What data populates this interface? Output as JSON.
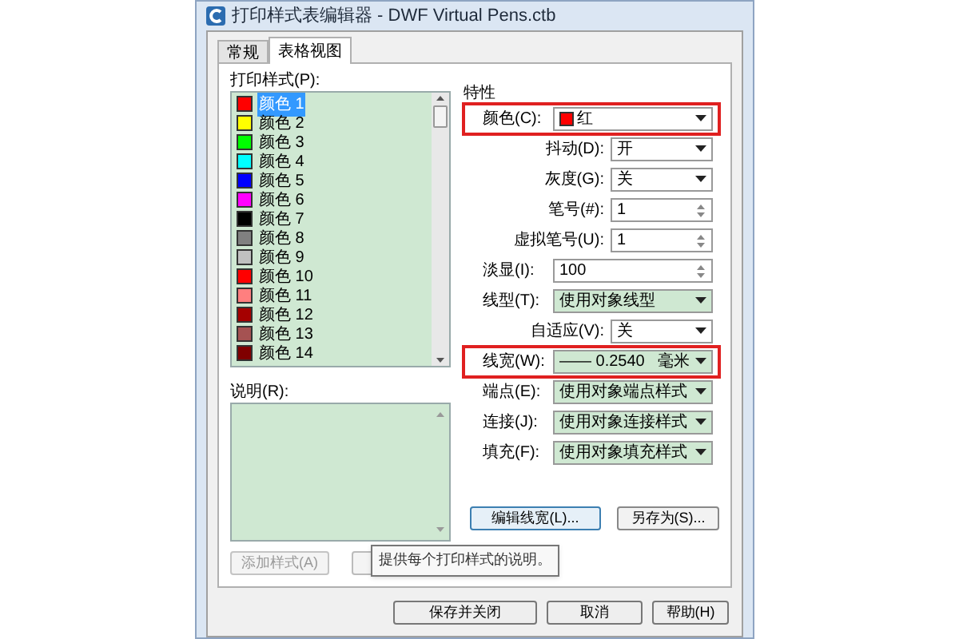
{
  "window": {
    "title": "打印样式表编辑器 - DWF Virtual Pens.ctb"
  },
  "tabs": [
    {
      "label": "常规",
      "selected": false
    },
    {
      "label": "表格视图",
      "selected": true
    }
  ],
  "styles_list": {
    "label": "打印样式(P):",
    "items": [
      {
        "label": "颜色 1",
        "color": "#ff0000",
        "selected": true
      },
      {
        "label": "颜色 2",
        "color": "#ffff00",
        "selected": false
      },
      {
        "label": "颜色 3",
        "color": "#00ff00",
        "selected": false
      },
      {
        "label": "颜色 4",
        "color": "#00ffff",
        "selected": false
      },
      {
        "label": "颜色 5",
        "color": "#0000ff",
        "selected": false
      },
      {
        "label": "颜色 6",
        "color": "#ff00ff",
        "selected": false
      },
      {
        "label": "颜色 7",
        "color": "#000000",
        "selected": false
      },
      {
        "label": "颜色 8",
        "color": "#808080",
        "selected": false
      },
      {
        "label": "颜色 9",
        "color": "#c0c0c0",
        "selected": false
      },
      {
        "label": "颜色 10",
        "color": "#ff0000",
        "selected": false
      },
      {
        "label": "颜色 11",
        "color": "#ff7f7f",
        "selected": false
      },
      {
        "label": "颜色 12",
        "color": "#a50000",
        "selected": false
      },
      {
        "label": "颜色 13",
        "color": "#a55252",
        "selected": false
      },
      {
        "label": "颜色 14",
        "color": "#7f0000",
        "selected": false
      }
    ]
  },
  "description": {
    "label": "说明(R):"
  },
  "add_style_button": {
    "label": "添加样式(A)",
    "disabled": true
  },
  "tooltip": "提供每个打印样式的说明。",
  "properties": {
    "label": "特性",
    "rows": [
      {
        "kind": "color-select",
        "label": "颜色(C):",
        "value": "红",
        "color": "#ff0000",
        "highlighted": true
      },
      {
        "kind": "select-short",
        "label": "抖动(D):",
        "value": "开",
        "highlighted": false
      },
      {
        "kind": "select-short",
        "label": "灰度(G):",
        "value": "关",
        "highlighted": false
      },
      {
        "kind": "spin-short",
        "label": "笔号(#):",
        "value": "1",
        "highlighted": false
      },
      {
        "kind": "spin-short",
        "label": "虚拟笔号(U):",
        "value": "1",
        "highlighted": false
      },
      {
        "kind": "spin-wide",
        "label": "淡显(I):",
        "value": "100",
        "highlighted": false
      },
      {
        "kind": "select-wide",
        "label": "线型(T):",
        "value": "使用对象线型",
        "highlighted": false
      },
      {
        "kind": "select-short",
        "label": "自适应(V):",
        "value": "关",
        "highlighted": false
      },
      {
        "kind": "select-wide",
        "label": "线宽(W):",
        "value": "—— 0.2540   毫米",
        "highlighted": true
      },
      {
        "kind": "select-wide",
        "label": "端点(E):",
        "value": "使用对象端点样式",
        "highlighted": false
      },
      {
        "kind": "select-wide",
        "label": "连接(J):",
        "value": "使用对象连接样式",
        "highlighted": false
      },
      {
        "kind": "select-wide",
        "label": "填充(F):",
        "value": "使用对象填充样式",
        "highlighted": false
      }
    ]
  },
  "edit_lineweights_button": "编辑线宽(L)...",
  "save_as_button": "另存为(S)...",
  "footer_buttons": [
    "保存并关闭",
    "取消",
    "帮助(H)"
  ]
}
